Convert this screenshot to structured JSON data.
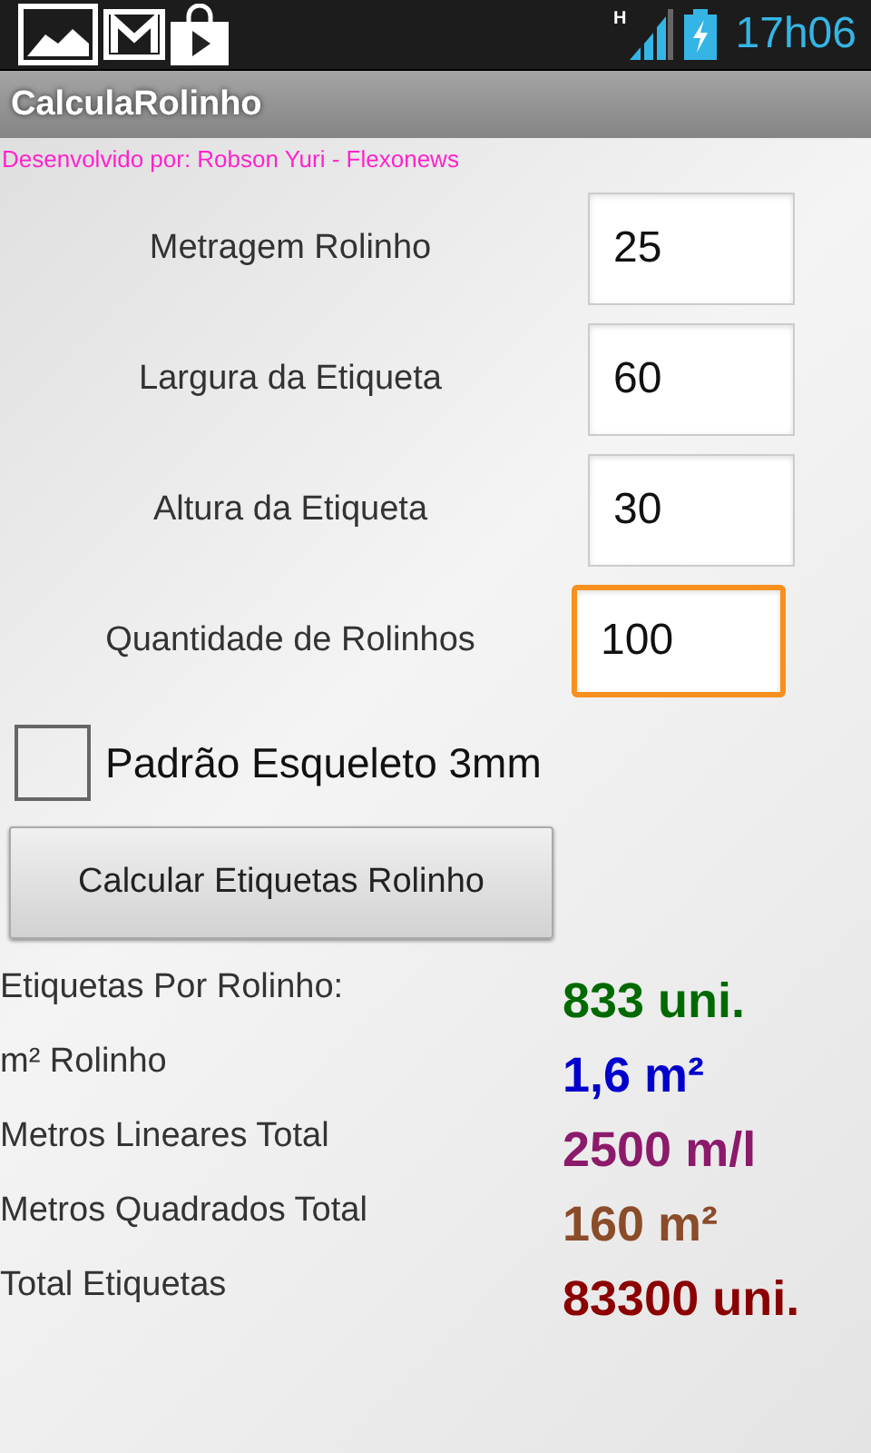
{
  "status_bar": {
    "network_type": "H",
    "time": "17h06"
  },
  "app_bar": {
    "title": "CalculaRolinho"
  },
  "credit": "Desenvolvido por: Robson Yuri - Flexonews",
  "fields": [
    {
      "label": "Metragem Rolinho",
      "value": "25",
      "focused": false
    },
    {
      "label": "Largura da Etiqueta",
      "value": "60",
      "focused": false
    },
    {
      "label": "Altura da Etiqueta",
      "value": "30",
      "focused": false
    },
    {
      "label": "Quantidade de Rolinhos",
      "value": "100",
      "focused": true
    }
  ],
  "checkbox": {
    "label": "Padrão Esqueleto 3mm",
    "checked": false
  },
  "button": "Calcular Etiquetas Rolinho",
  "results": [
    {
      "label": "Etiquetas Por Rolinho:",
      "value": "833 uni.",
      "color": "#006a00"
    },
    {
      "label": "m² Rolinho",
      "value": "1,6 m²",
      "color": "#0000cc"
    },
    {
      "label": "Metros Lineares Total",
      "value": "2500 m/l",
      "color": "#8c1a6a"
    },
    {
      "label": "Metros Quadrados Total",
      "value": "160 m²",
      "color": "#8b4c2a"
    },
    {
      "label": "Total Etiquetas",
      "value": "83300 uni.",
      "color": "#8b0000"
    }
  ]
}
